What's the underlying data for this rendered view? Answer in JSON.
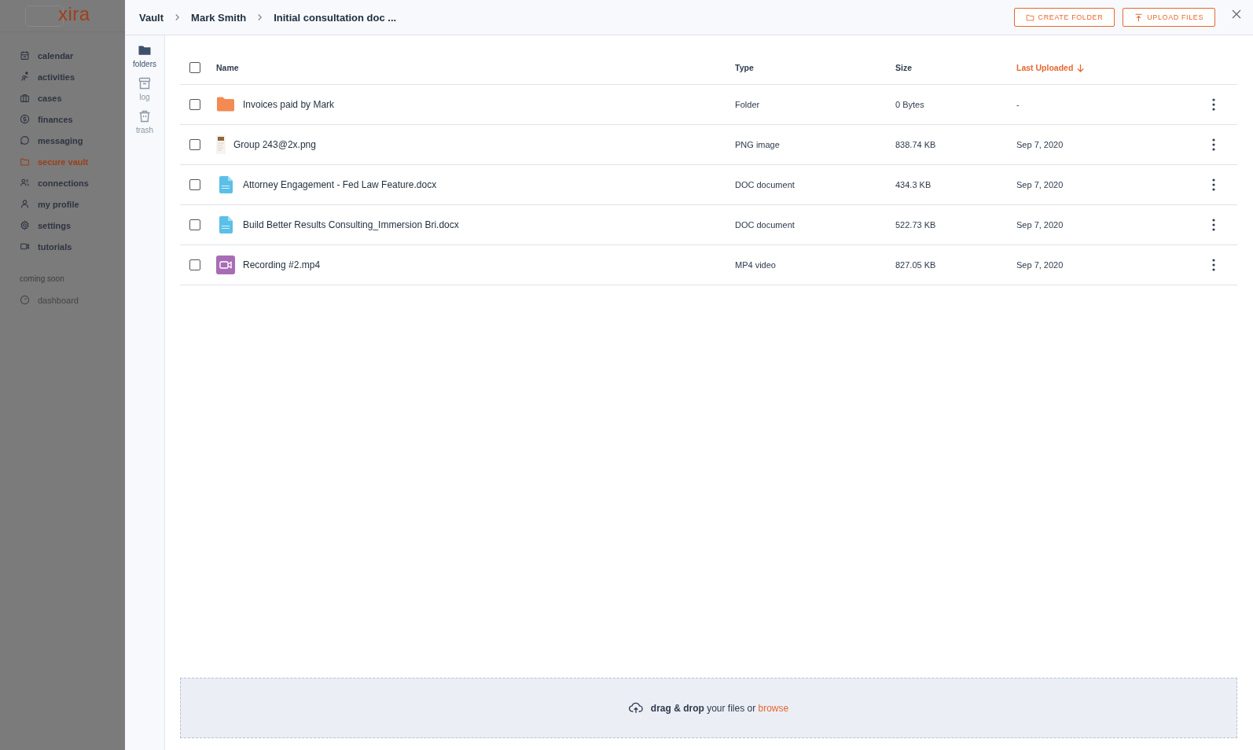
{
  "sidebar": {
    "logo": "xira",
    "items": [
      {
        "label": "calendar",
        "selected": false
      },
      {
        "label": "activities",
        "selected": false
      },
      {
        "label": "cases",
        "selected": false
      },
      {
        "label": "finances",
        "selected": false
      },
      {
        "label": "messaging",
        "selected": false
      },
      {
        "label": "secure vault",
        "selected": true
      },
      {
        "label": "connections",
        "selected": false
      },
      {
        "label": "my profile",
        "selected": false
      },
      {
        "label": "settings",
        "selected": false
      },
      {
        "label": "tutorials",
        "selected": false
      }
    ],
    "section_label": "coming soon",
    "soon_items": [
      {
        "label": "dashboard",
        "disabled": true
      }
    ]
  },
  "breadcrumbs": [
    "Vault",
    "Mark Smith",
    "Initial consultation doc ..."
  ],
  "actions": [
    "CREATE FOLDER",
    "UPLOAD FILES"
  ],
  "rail": [
    {
      "label": "folders",
      "selected": true
    },
    {
      "label": "log",
      "selected": false
    },
    {
      "label": "trash",
      "selected": false
    }
  ],
  "table": {
    "select_all_checked": false,
    "columns": [
      {
        "label": "Name",
        "sorted": false
      },
      {
        "label": "Type",
        "sorted": false
      },
      {
        "label": "Size",
        "sorted": false
      },
      {
        "label": "Last Uploaded",
        "sorted": true
      }
    ],
    "rows": [
      {
        "kind": "folder",
        "name": "Invoices paid by Mark",
        "type": "Folder",
        "size": "0 Bytes",
        "uploaded": "-",
        "checked": false
      },
      {
        "kind": "image",
        "name": "Group 243@2x.png",
        "type": "PNG image",
        "size": "838.74 KB",
        "uploaded": "Sep 7, 2020",
        "checked": false
      },
      {
        "kind": "doc",
        "name": "Attorney Engagement - Fed Law Feature.docx",
        "type": "DOC document",
        "size": "434.3 KB",
        "uploaded": "Sep 7, 2020",
        "checked": false
      },
      {
        "kind": "doc",
        "name": "Build Better Results Consulting_Immersion Bri.docx",
        "type": "DOC document",
        "size": "522.73 KB",
        "uploaded": "Sep 7, 2020",
        "checked": false
      },
      {
        "kind": "video",
        "name": "Recording #2.mp4",
        "type": "MP4 video",
        "size": "827.05 KB",
        "uploaded": "Sep 7, 2020",
        "checked": false
      }
    ]
  },
  "dropzone": {
    "text": "**drag & drop** your files or",
    "link": "browse"
  }
}
